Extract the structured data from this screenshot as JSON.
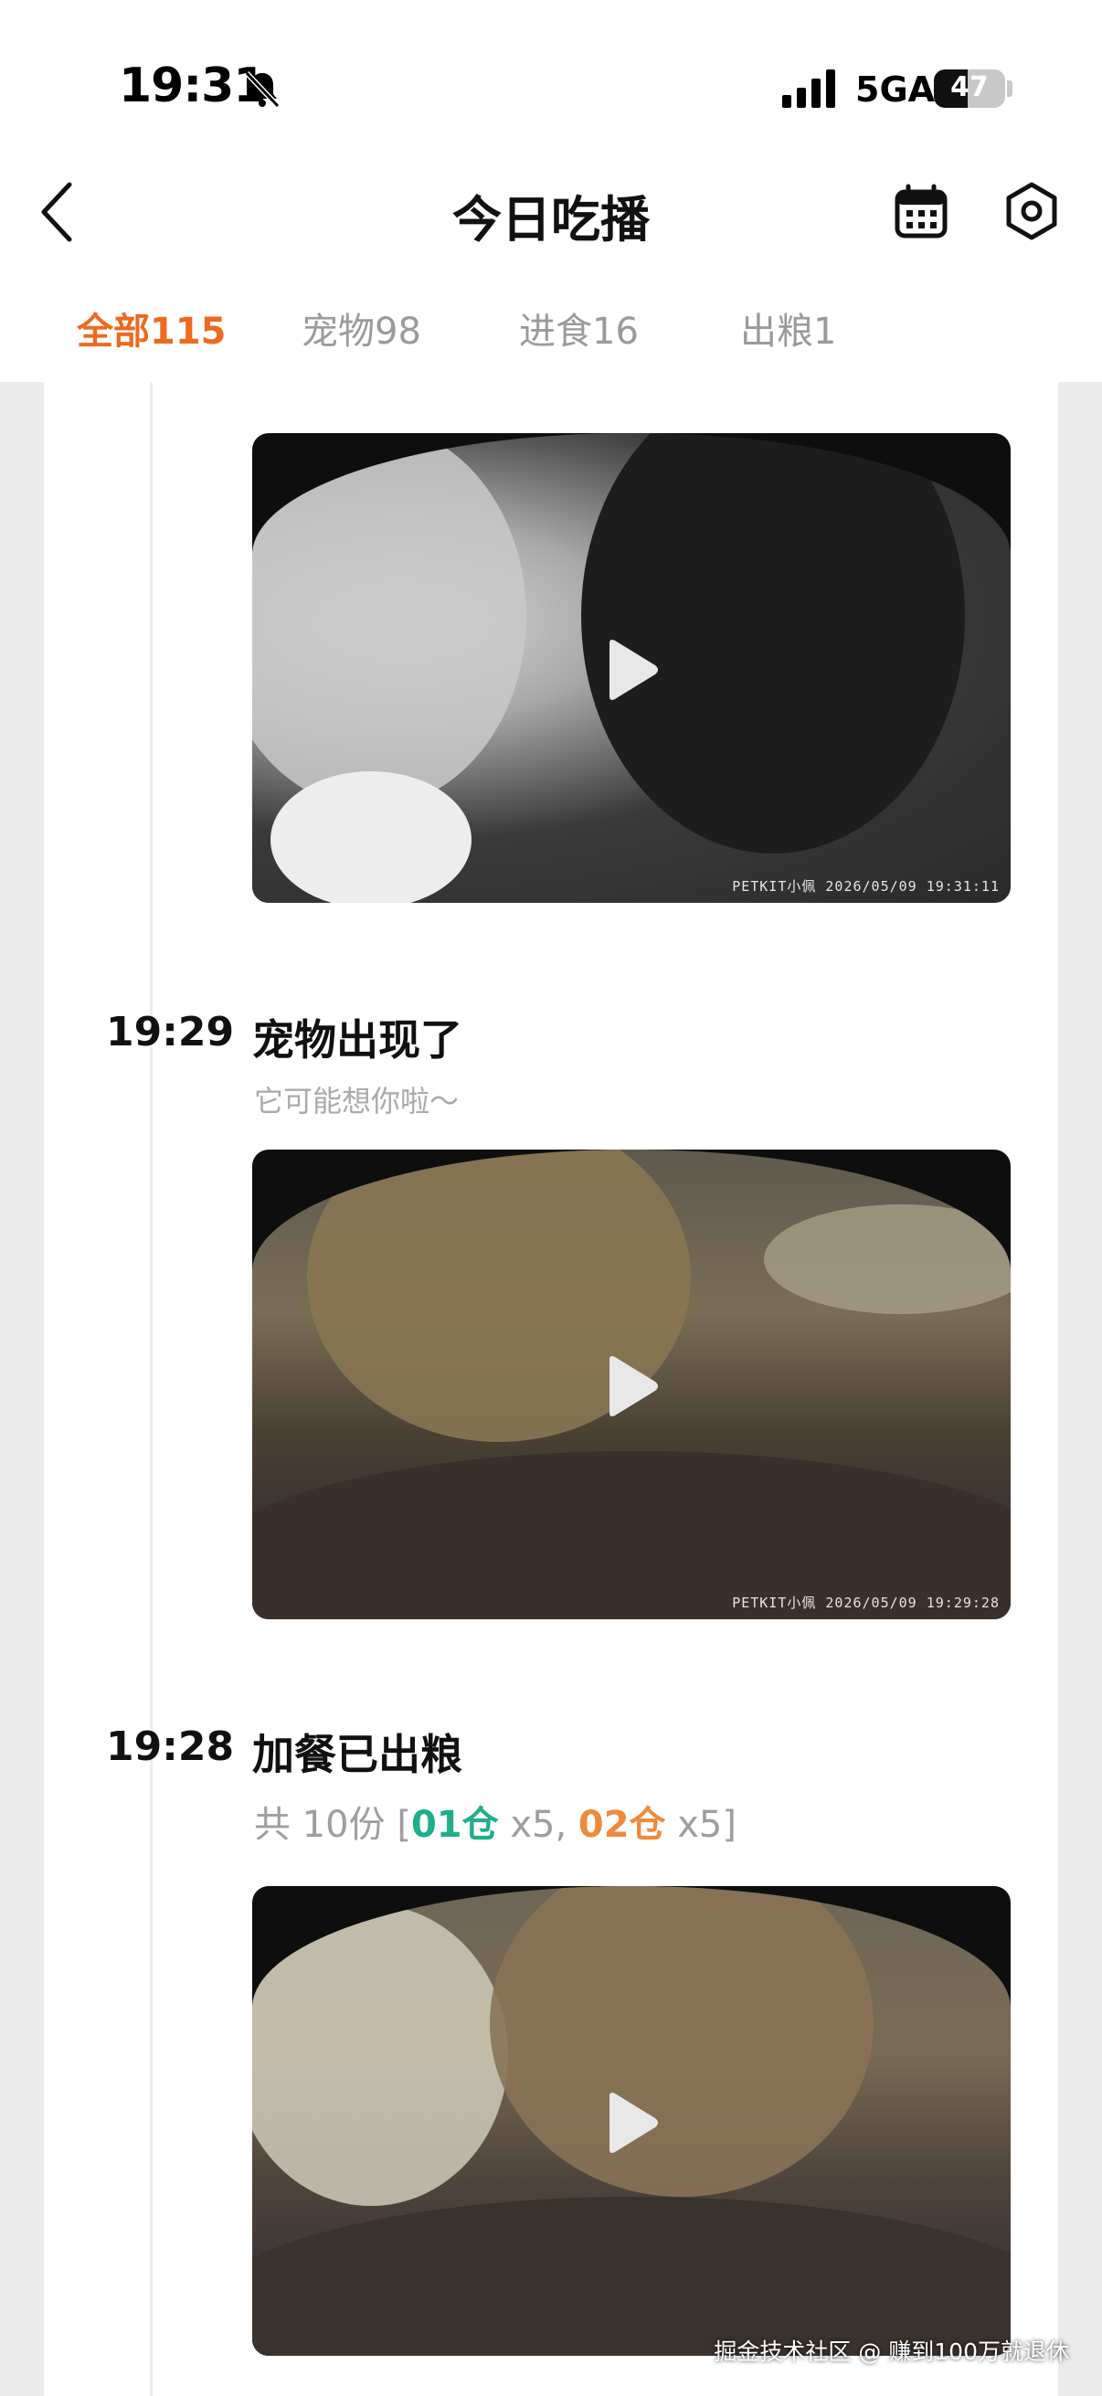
{
  "status_bar": {
    "time": "19:31",
    "network": "5GA",
    "battery": "47",
    "battery_level": 0.47
  },
  "nav": {
    "title": "今日吃播"
  },
  "tabs": [
    {
      "label": "全部115",
      "active": true
    },
    {
      "label": "宠物98",
      "active": false
    },
    {
      "label": "进食16",
      "active": false
    },
    {
      "label": "出粮1",
      "active": false
    }
  ],
  "events": [
    {
      "video_watermark": "PETKIT小佩  2026/05/09  19:31:11"
    },
    {
      "time": "19:29",
      "title": "宠物出现了",
      "subtitle": "它可能想你啦～",
      "video_watermark": "PETKIT小佩  2026/05/09  19:29:28"
    },
    {
      "time": "19:28",
      "title": "加餐已出粮",
      "detail": {
        "prefix": "共 10份 [",
        "bin1_label": "01仓",
        "bin1_count": " x5, ",
        "bin2_label": "02仓",
        "bin2_count": " x5]"
      }
    }
  ],
  "credit": "掘金技术社区 @ 赚到100万就退休",
  "colors": {
    "accent": "#ee6a1f",
    "bin1": "#1fae8b",
    "bin2": "#ef8a3d"
  }
}
